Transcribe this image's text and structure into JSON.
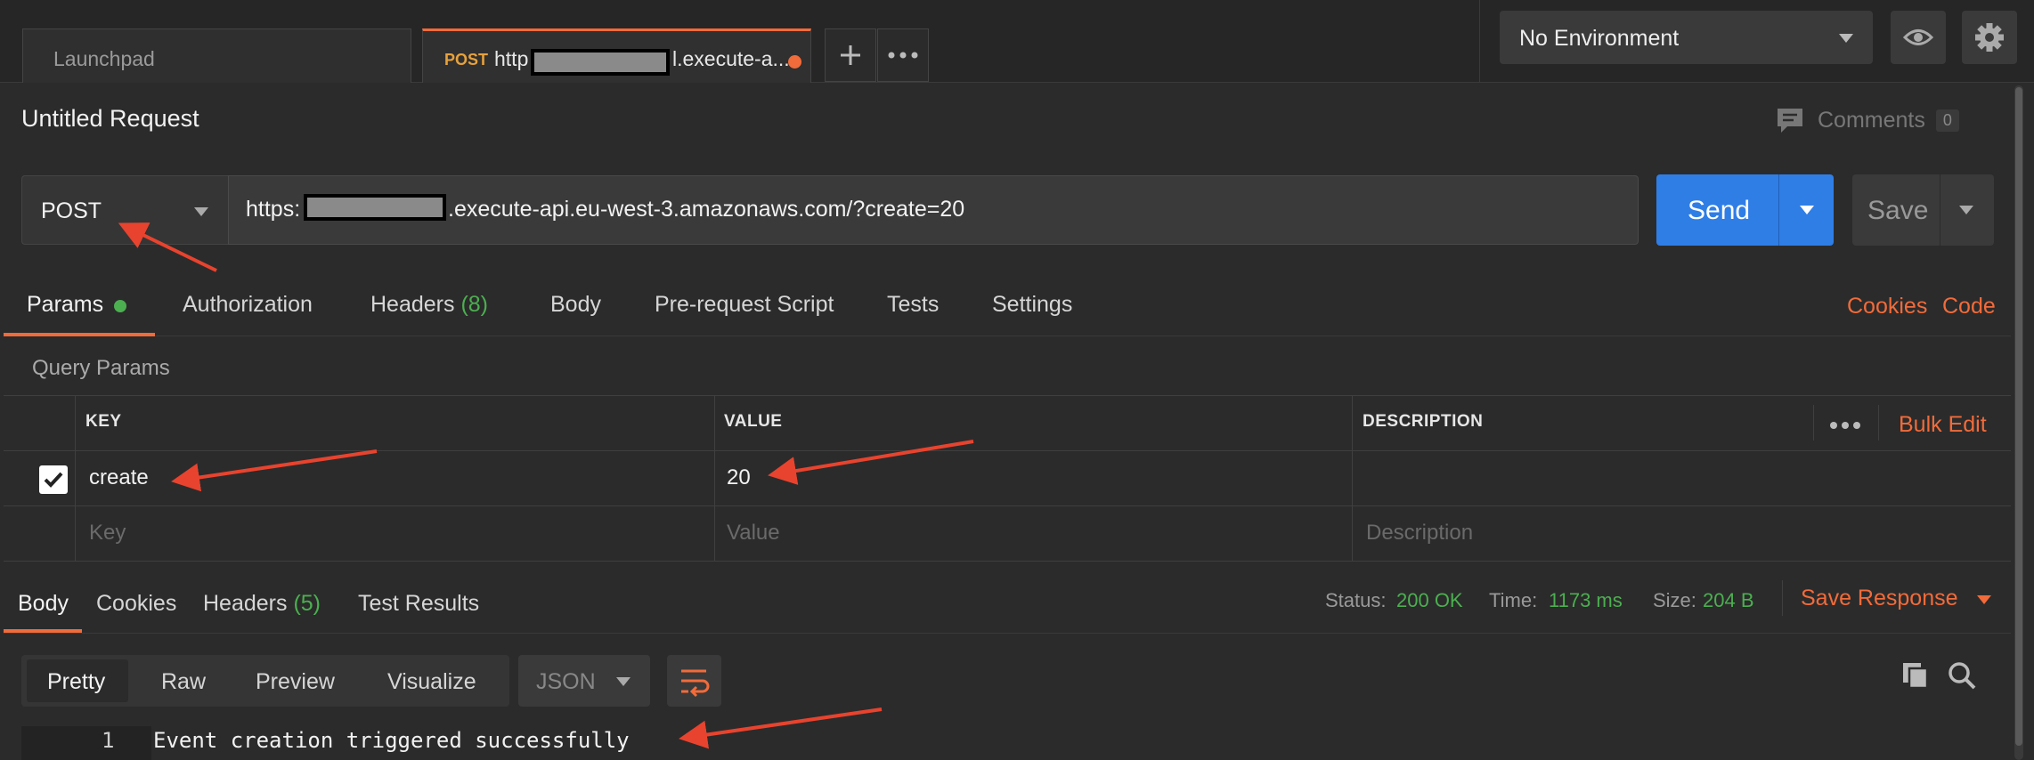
{
  "tabs": {
    "launchpad": "Launchpad",
    "active_method": "POST",
    "active_url_start": "http",
    "active_url_end": "l.execute-a..."
  },
  "environment": {
    "selected": "No Environment"
  },
  "request": {
    "title": "Untitled Request",
    "comments_label": "Comments",
    "comments_count": "0",
    "method": "POST",
    "url_prefix": "https:",
    "url_suffix": ".execute-api.eu-west-3.amazonaws.com/?create=20",
    "send_label": "Send",
    "save_label": "Save"
  },
  "request_tabs": {
    "params": "Params",
    "authorization": "Authorization",
    "headers": "Headers",
    "headers_count": "(8)",
    "body": "Body",
    "prerequest": "Pre-request Script",
    "tests": "Tests",
    "settings": "Settings",
    "cookies": "Cookies",
    "code": "Code"
  },
  "query_params": {
    "title": "Query Params",
    "col_key": "KEY",
    "col_value": "VALUE",
    "col_description": "DESCRIPTION",
    "bulk_edit": "Bulk Edit",
    "rows": [
      {
        "key": "create",
        "value": "20",
        "checked": true
      }
    ],
    "placeholder_key": "Key",
    "placeholder_value": "Value",
    "placeholder_description": "Description"
  },
  "response_tabs": {
    "body": "Body",
    "cookies": "Cookies",
    "headers": "Headers",
    "headers_count": "(5)",
    "test_results": "Test Results"
  },
  "response_status": {
    "status_label": "Status:",
    "status_value": "200 OK",
    "time_label": "Time:",
    "time_value": "1173 ms",
    "size_label": "Size:",
    "size_value": "204 B",
    "save_response": "Save Response"
  },
  "response_view": {
    "modes": [
      "Pretty",
      "Raw",
      "Preview",
      "Visualize"
    ],
    "format": "JSON",
    "lines": [
      {
        "number": "1",
        "text": "Event creation triggered successfully"
      }
    ]
  },
  "colors": {
    "accent": "#f26b3a",
    "send": "#2f7ee6",
    "success": "#4caf50",
    "annotation_arrow": "#e8432e"
  }
}
